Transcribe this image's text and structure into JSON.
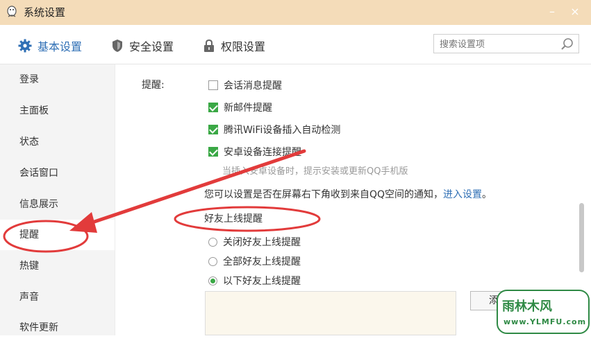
{
  "window": {
    "title": "系统设置",
    "minimize": "–",
    "close": "×"
  },
  "toolbar": {
    "tabs": [
      {
        "label": "基本设置",
        "icon": "gear-icon"
      },
      {
        "label": "安全设置",
        "icon": "shield-icon"
      },
      {
        "label": "权限设置",
        "icon": "lock-icon"
      }
    ],
    "search_placeholder": "搜索设置项"
  },
  "sidebar": {
    "items": [
      {
        "label": "登录"
      },
      {
        "label": "主面板"
      },
      {
        "label": "状态"
      },
      {
        "label": "会话窗口"
      },
      {
        "label": "信息展示"
      },
      {
        "label": "提醒",
        "selected": true
      },
      {
        "label": "热键"
      },
      {
        "label": "声音"
      },
      {
        "label": "软件更新"
      }
    ]
  },
  "main": {
    "reminder_label": "提醒:",
    "checkboxes": [
      {
        "label": "会话消息提醒",
        "checked": false
      },
      {
        "label": "新邮件提醒",
        "checked": true
      },
      {
        "label": "腾讯WiFi设备插入自动检测",
        "checked": true
      },
      {
        "label": "安卓设备连接提醒",
        "checked": true
      }
    ],
    "android_hint": "当插入安卓设备时，提示安装或更新QQ手机版",
    "qzone_text": "您可以设置是否在屏幕右下角收到来自QQ空间的通知，",
    "qzone_link": "进入设置",
    "qzone_end": "。",
    "friend_online_title": "好友上线提醒",
    "radios": [
      {
        "label": "关闭好友上线提醒",
        "checked": false
      },
      {
        "label": "全部好友上线提醒",
        "checked": false
      },
      {
        "label": "以下好友上线提醒",
        "checked": true
      }
    ],
    "add_button_label": "添"
  },
  "watermark": {
    "brand": "雨林木风",
    "url": "www.YLMFU.com"
  },
  "colors": {
    "accent": "#2f6fb5",
    "check": "#3aa845",
    "annotation": "#e23b3b",
    "titlebar": "#f4dcb9"
  }
}
